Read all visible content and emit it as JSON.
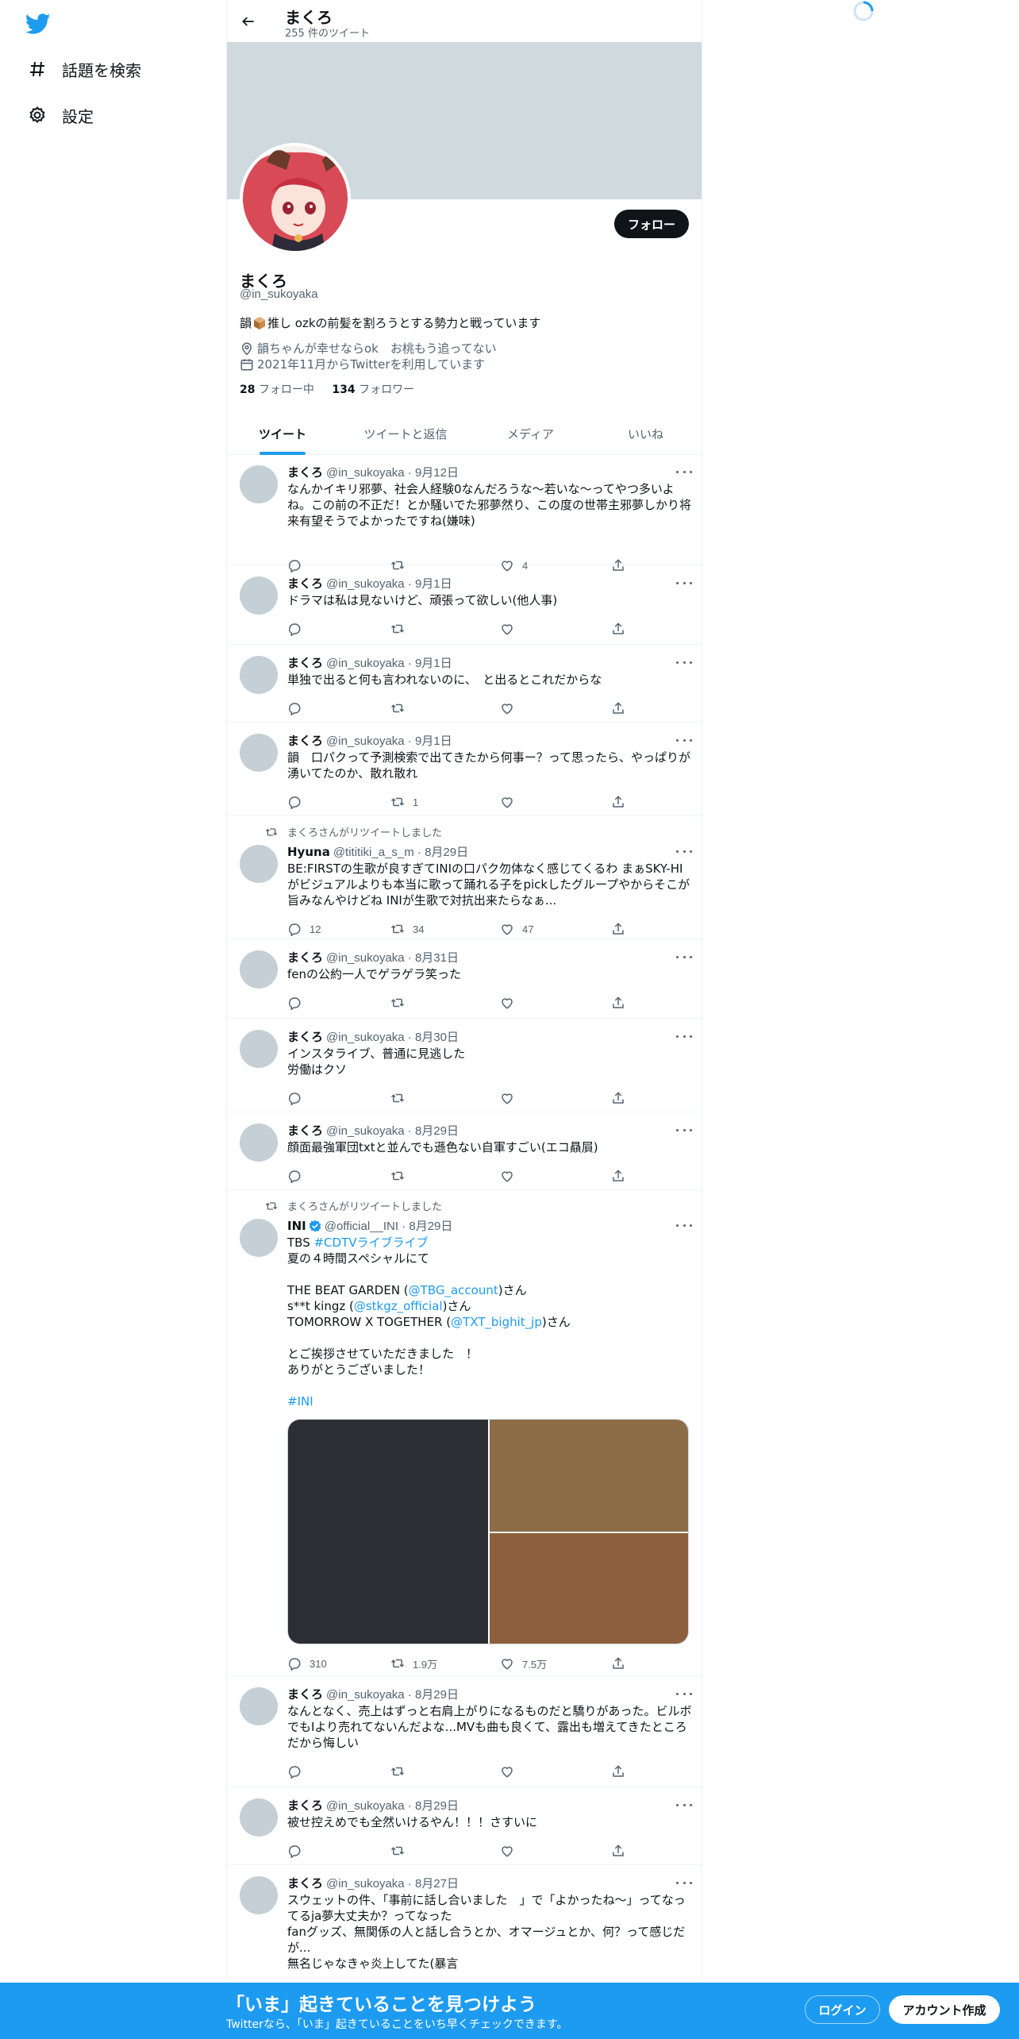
{
  "nav": {
    "logo": "twitter-bird-icon",
    "items": [
      {
        "icon": "hashtag-icon",
        "label": "話題を検索"
      },
      {
        "icon": "gear-icon",
        "label": "設定"
      }
    ]
  },
  "header": {
    "name": "まくろ",
    "tweet_count": "255 件のツイート"
  },
  "profile": {
    "name": "まくろ",
    "handle": "@in_sukoyaka",
    "bio_prefix": "韻",
    "bio_suffix": "推し ozkの前髪を割ろうとする勢力と戦っています",
    "location": "韻ちゃんが幸せならok　お桃もう追ってない",
    "joined": "2021年11月からTwitterを利用しています",
    "following_count": "28",
    "following_label": " フォロー中",
    "followers_count": "134",
    "followers_label": " フォロワー",
    "follow_button": "フォロー"
  },
  "tabs": [
    "ツイート",
    "ツイートと返信",
    "メディア",
    "いいね"
  ],
  "tweets": [
    {
      "name": "まくろ",
      "meta": "@in_sukoyaka · 9月12日",
      "text": "なんかイキリ邪夢、社会人経験0なんだろうな〜若いな〜ってやつ多いよね。この前の不正だ！とか騒いでた邪夢然り、この度の世帯主邪夢しかり将来有望そうでよかったですね(嫌味)",
      "reply": "",
      "retweet": "",
      "like": "4"
    },
    {
      "name": "まくろ",
      "meta": "@in_sukoyaka · 9月1日",
      "text": "ドラマは私は見ないけど、頑張って欲しい(他人事)",
      "reply": "",
      "retweet": "",
      "like": ""
    },
    {
      "name": "まくろ",
      "meta": "@in_sukoyaka · 9月1日",
      "text": "単独で出ると何も言われないのに、　と出るとこれだからな",
      "reply": "",
      "retweet": "",
      "like": ""
    },
    {
      "name": "まくろ",
      "meta": "@in_sukoyaka · 9月1日",
      "text": "韻　口パクって予測検索で出てきたから何事ー？って思ったら、やっぱりが湧いてたのか、散れ散れ",
      "reply": "",
      "retweet": "1",
      "like": ""
    },
    {
      "retweeted_by": "まくろさんがリツイートしました",
      "name": "Hyuna",
      "meta": "@tititiki_a_s_m · 8月29日",
      "text": "BE:FIRSTの生歌が良すぎてINIの口パク勿体なく感じてくるわ まぁSKY-HIがビジュアルよりも本当に歌って踊れる子をpickしたグループやからそこが旨みなんやけどね INIが生歌で対抗出来たらなぁ...",
      "reply": "12",
      "retweet": "34",
      "like": "47"
    },
    {
      "name": "まくろ",
      "meta": "@in_sukoyaka · 8月31日",
      "text": "fenの公約一人でゲラゲラ笑った",
      "reply": "",
      "retweet": "",
      "like": ""
    },
    {
      "name": "まくろ",
      "meta": "@in_sukoyaka · 8月30日",
      "text": "インスタライブ、普通に見逃した\n労働はクソ",
      "reply": "",
      "retweet": "",
      "like": ""
    },
    {
      "name": "まくろ",
      "meta": "@in_sukoyaka · 8月29日",
      "text": "顔面最強軍団txtと並んでも遜色ない自軍すごい(エコ贔屓)",
      "reply": "",
      "retweet": "",
      "like": ""
    },
    {
      "retweeted_by": "まくろさんがリツイートしました",
      "name": "INI",
      "meta": "@official__INI · 8月29日",
      "text_parts": [
        {
          "t": "TBS "
        },
        {
          "t": "#CDTVライブライブ",
          "link": true
        },
        {
          "t": "\n夏の４時間スペシャルにて\n\nTHE BEAT GARDEN ("
        },
        {
          "t": "@TBG_account",
          "link": true
        },
        {
          "t": ")さん\ns**t kingz ("
        },
        {
          "t": "@stkgz_official",
          "link": true
        },
        {
          "t": ")さん\nTOMORROW X TOGETHER ("
        },
        {
          "t": "@TXT_bighit_jp",
          "link": true
        },
        {
          "t": ")さん\n\nとご挨拶させていただきました　！\nありがとうございました！\n\n"
        },
        {
          "t": "#INI",
          "link": true
        }
      ],
      "reply": "310",
      "retweet": "1.9万",
      "like": "7.5万"
    },
    {
      "name": "まくろ",
      "meta": "@in_sukoyaka · 8月29日",
      "text": "なんとなく、売上はずっと右肩上がりになるものだと驕りがあった。ビルボでもIより売れてないんだよな...MVも曲も良くて、露出も増えてきたところだから悔しい",
      "reply": "",
      "retweet": "",
      "like": ""
    },
    {
      "name": "まくろ",
      "meta": "@in_sukoyaka · 8月29日",
      "text": "被せ控えめでも全然いけるやん！！！さすいに",
      "reply": "",
      "retweet": "",
      "like": ""
    },
    {
      "name": "まくろ",
      "meta": "@in_sukoyaka · 8月27日",
      "text": "スウェットの件、「事前に話し合いました　」で「よかったね〜」ってなってるja夢大丈夫か？ってなった\nfanグッズ、無関係の人と話し合うとか、オマージュとか、何？って感じだが...\n無名じゃなきゃ炎上してた(暴言",
      "reply": "",
      "retweet": "",
      "like": ""
    }
  ],
  "bottom_bar": {
    "title": "「いま」起きていることを見つけよう",
    "subtitle": "Twitterなら、「いま」起きていることをいち早くチェックできます。",
    "login": "ログイン",
    "signup": "アカウント作成"
  },
  "colors": {
    "accent": "#1d9bf0",
    "text": "#0f1419",
    "muted": "#536471",
    "banner": "#cfd9de"
  }
}
